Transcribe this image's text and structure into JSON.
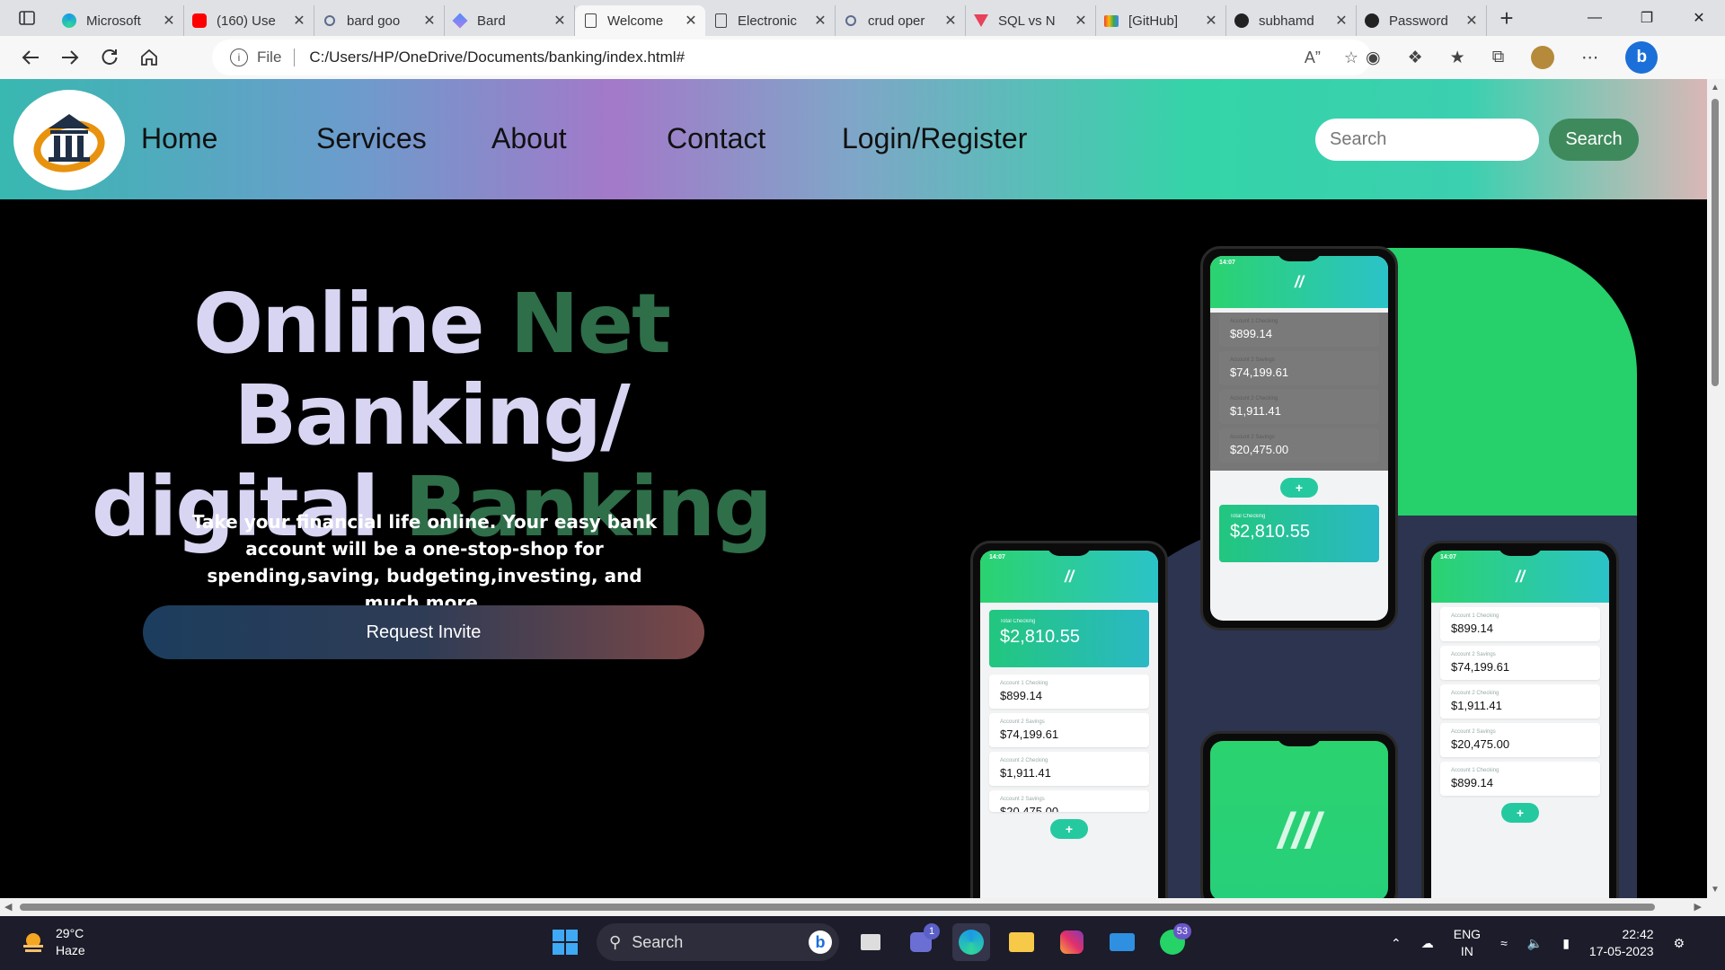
{
  "browser": {
    "tabs": [
      {
        "title": "Microsoft",
        "icon": "edge-icon"
      },
      {
        "title": "(160) Use",
        "icon": "youtube-icon"
      },
      {
        "title": "bard goo",
        "icon": "search-icon"
      },
      {
        "title": "Bard",
        "icon": "bard-icon"
      },
      {
        "title": "Welcome",
        "icon": "page-icon"
      },
      {
        "title": "Electronic",
        "icon": "page-icon"
      },
      {
        "title": "crud oper",
        "icon": "search-icon"
      },
      {
        "title": "SQL vs N",
        "icon": "vercel-icon"
      },
      {
        "title": "[GitHub]",
        "icon": "gmail-icon"
      },
      {
        "title": "subhamd",
        "icon": "github-icon"
      },
      {
        "title": "Password",
        "icon": "github-icon"
      }
    ],
    "active_tab_index": 4,
    "address": {
      "scheme_label": "File",
      "url": "C:/Users/HP/OneDrive/Documents/banking/index.html#"
    }
  },
  "site": {
    "nav": [
      "Home",
      "Services",
      "About",
      "Contact",
      "Login/Register"
    ],
    "search": {
      "placeholder": "Search",
      "button": "Search"
    },
    "hero": {
      "line1_a": "Online ",
      "line1_b": "Net",
      "line1_c": " Banking/",
      "line2_a": "digital ",
      "line2_b": "Banking",
      "subtitle": "Take your financial life online. Your easy bank account will be a one-stop-shop for spending,saving, budgeting,investing, and much more.",
      "cta": "Request Invite"
    },
    "phones": {
      "time": "14:07",
      "total_label": "Total Checking",
      "total_value": "$2,810.55",
      "accounts": [
        {
          "label": "Account 1 Checking",
          "value": "$899.14"
        },
        {
          "label": "Account 2 Savings",
          "value": "$74,199.61"
        },
        {
          "label": "Account 2 Checking",
          "value": "$1,911.41"
        },
        {
          "label": "Account 2 Savings",
          "value": "$20,475.00"
        },
        {
          "label": "Account 1 Checking",
          "value": "$899.14"
        }
      ]
    },
    "colors": {
      "accent_green": "#2e6e49",
      "title_lavender": "#d7d5f2",
      "search_button": "#3f8a5c"
    }
  },
  "taskbar": {
    "weather": {
      "temp": "29°C",
      "condition": "Haze"
    },
    "search_label": "Search",
    "teams_badge": "1",
    "whatsapp_badge": "53",
    "lang": {
      "line1": "ENG",
      "line2": "IN"
    },
    "clock": {
      "time": "22:42",
      "date": "17-05-2023"
    }
  }
}
